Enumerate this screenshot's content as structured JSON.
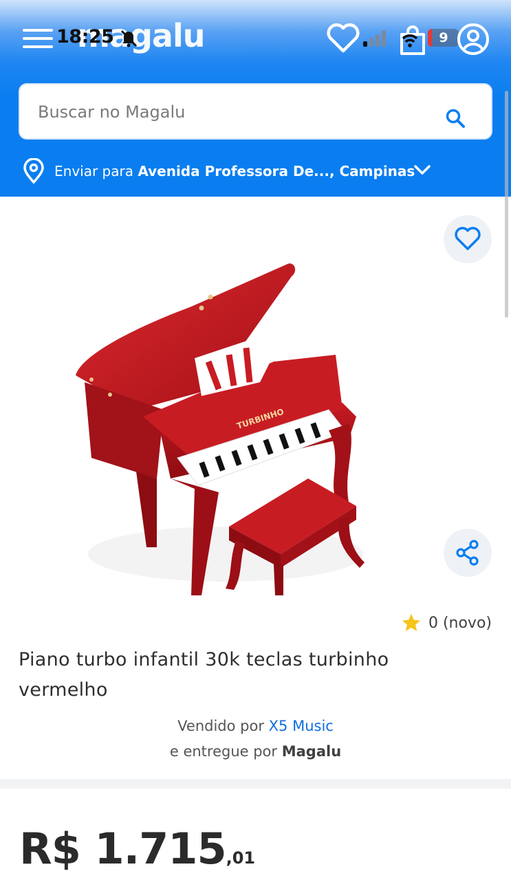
{
  "status_bar": {
    "time": "18:25",
    "battery": "9"
  },
  "header": {
    "logo": "magalu"
  },
  "search": {
    "placeholder": "Buscar no Magalu"
  },
  "delivery": {
    "prefix": "Enviar para",
    "address": "Avenida Professora De..., Campinas"
  },
  "product": {
    "rating_value": "0",
    "rating_label": "(novo)",
    "title": "Piano turbo infantil 30k teclas turbinho vermelho",
    "sold_by_prefix": "Vendido por",
    "seller": "X5 Music",
    "delivered_by_prefix": "e entregue por",
    "deliverer": "Magalu",
    "price_main": "R$ 1.715",
    "price_cents": ",01",
    "image_brand": "TURBINHO"
  },
  "colors": {
    "brand_blue": "#0a7ef0",
    "link_blue": "#0f6fde",
    "star": "#f5c518",
    "piano_red": "#c8181f"
  }
}
